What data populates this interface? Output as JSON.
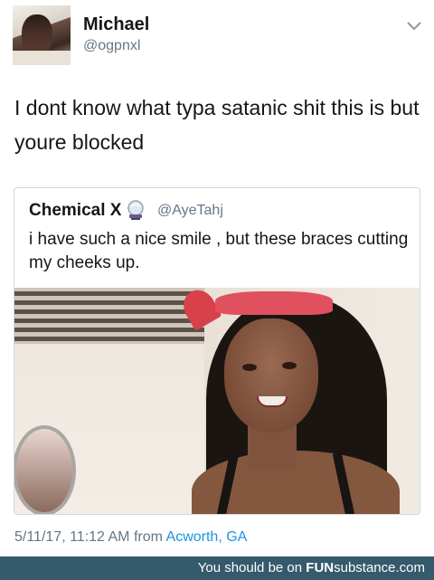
{
  "author": {
    "name": "Michael",
    "handle": "@ogpnxl"
  },
  "tweet": {
    "text": "I dont know what typa satanic shit this is but youre blocked"
  },
  "quoted_tweet": {
    "name": "Chemical X",
    "emoji_icon": "crystal-ball-emoji",
    "handle": "@AyeTahj",
    "text": "i have such a nice smile , but these braces cutting my cheeks up."
  },
  "meta": {
    "timestamp": "5/11/17, 11:12 AM from",
    "location": "Acworth, GA"
  },
  "footer": {
    "prefix": "You should be on",
    "brand_bold": "FUN",
    "brand_rest": "substance.com"
  },
  "colors": {
    "link": "#1b95e0",
    "muted": "#657786",
    "footer_bg": "#355a6b"
  }
}
